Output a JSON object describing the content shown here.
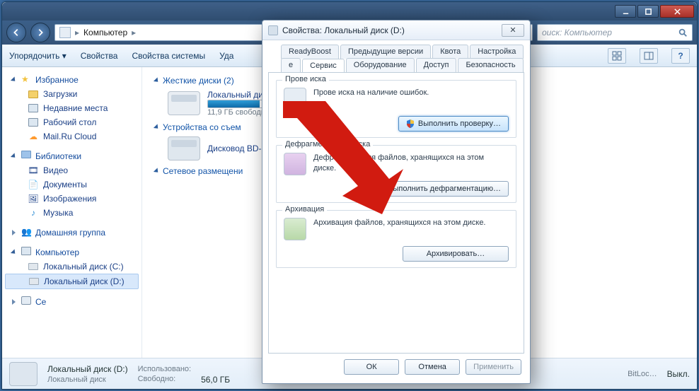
{
  "explorer": {
    "address": {
      "root": "Компьютер"
    },
    "search_placeholder": "оиск: Компьютер",
    "toolbar": {
      "organize": "Упорядочить ▾",
      "properties": "Свойства",
      "system_properties": "Свойства системы",
      "uninstall_truncated": "Уда"
    },
    "sidebar": {
      "favorites": {
        "label": "Избранное",
        "items": [
          "Загрузки",
          "Недавние места",
          "Рабочий стол",
          "Mail.Ru Cloud"
        ]
      },
      "libraries": {
        "label": "Библиотеки",
        "items": [
          "Видео",
          "Документы",
          "Изображения",
          "Музыка"
        ]
      },
      "homegroup": {
        "label": "Домашняя группа"
      },
      "computer": {
        "label": "Компьютер",
        "items": [
          "Локальный диск (C:)",
          "Локальный диск (D:)"
        ]
      },
      "network_truncated": "Се"
    },
    "main": {
      "hdd_header": "Жесткие диски (2)",
      "hdd_item_name_truncated": "Локальный дис",
      "hdd_item_free_truncated": "11,9 ГБ свободн",
      "hdd_bar_percent": 62,
      "removable_header_truncated": "Устройства со съем",
      "removable_item_truncated": "Дисковод BD-R",
      "network_header_truncated": "Сетевое размещени"
    },
    "status": {
      "name": "Локальный диск (D:)",
      "sub": "Локальный диск",
      "used_label": "Использовано:",
      "free_label": "Свободно:",
      "free_value": "56,0 ГБ",
      "bitlocker_label": "BitLoc…",
      "bitlocker_value": "Выкл."
    }
  },
  "dialog": {
    "title": "Свойства: Локальный диск (D:)",
    "tabs_row1": [
      "ReadyBoost",
      "Предыдущие версии",
      "Квота",
      "Настройка"
    ],
    "tabs_row2_first_truncated": "е",
    "tabs_row2_rest": [
      "Сервис",
      "Оборудование",
      "Доступ",
      "Безопасность"
    ],
    "active_tab_index_row2": 1,
    "check": {
      "legend_truncated": "Прове          иска",
      "text_truncated": "Прове        иска на наличие ошибок.",
      "button": "Выполнить проверку…"
    },
    "defrag": {
      "legend": "Дефрагментация диска",
      "text": "Дефрагментация файлов, хранящихся на этом диске.",
      "button": "Выполнить дефрагментацию…"
    },
    "backup": {
      "legend": "Архивация",
      "text": "Архивация файлов, хранящихся на этом диске.",
      "button": "Архивировать…"
    },
    "buttons": {
      "ok": "ОК",
      "cancel": "Отмена",
      "apply": "Применить"
    }
  }
}
